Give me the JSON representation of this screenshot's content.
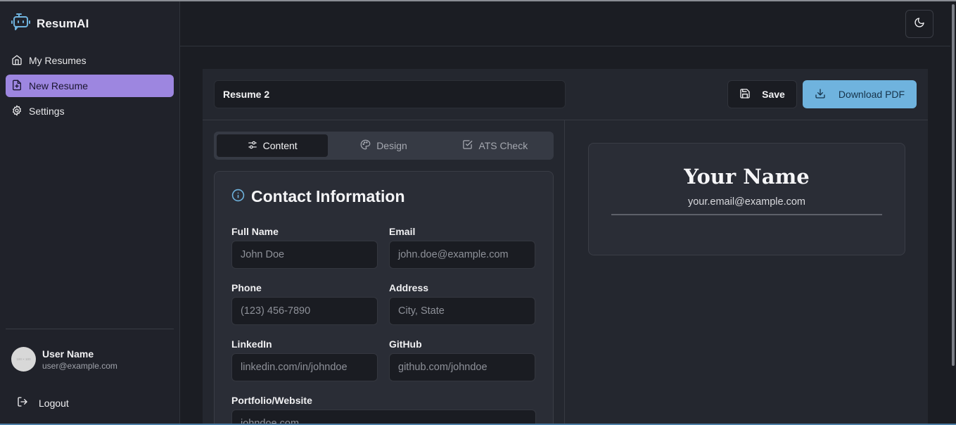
{
  "app": {
    "name": "ResumAI"
  },
  "sidebar": {
    "items": [
      {
        "label": "My Resumes",
        "icon": "home-icon"
      },
      {
        "label": "New Resume",
        "icon": "file-plus-icon"
      },
      {
        "label": "Settings",
        "icon": "gear-icon"
      }
    ],
    "user": {
      "name": "User Name",
      "email": "user@example.com",
      "avatar_text": "100 × 100"
    },
    "logout_label": "Logout"
  },
  "header": {
    "theme_icon": "moon-icon"
  },
  "editor": {
    "resume_title": "Resume 2",
    "save_label": "Save",
    "download_label": "Download PDF",
    "accent_color": "#6fb3de",
    "active_nav_color": "#9d86e0"
  },
  "tabs": [
    {
      "label": "Content",
      "icon": "sliders-icon",
      "active": true
    },
    {
      "label": "Design",
      "icon": "palette-icon",
      "active": false
    },
    {
      "label": "ATS Check",
      "icon": "check-square-icon",
      "active": false
    }
  ],
  "contact": {
    "title": "Contact Information",
    "fields": {
      "full_name": {
        "label": "Full Name",
        "placeholder": "John Doe"
      },
      "email": {
        "label": "Email",
        "placeholder": "john.doe@example.com"
      },
      "phone": {
        "label": "Phone",
        "placeholder": "(123) 456-7890"
      },
      "address": {
        "label": "Address",
        "placeholder": "City, State"
      },
      "linkedin": {
        "label": "LinkedIn",
        "placeholder": "linkedin.com/in/johndoe"
      },
      "github": {
        "label": "GitHub",
        "placeholder": "github.com/johndoe"
      },
      "portfolio": {
        "label": "Portfolio/Website",
        "placeholder": "johndoe.com"
      }
    }
  },
  "preview": {
    "name": "Your Name",
    "email": "your.email@example.com"
  }
}
